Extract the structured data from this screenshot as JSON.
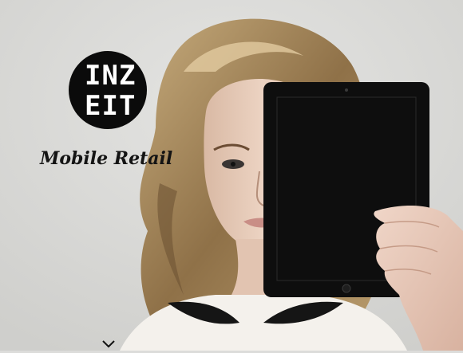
{
  "brand": {
    "logo_line1": "INZ",
    "logo_line2": "EIT"
  },
  "hero": {
    "tagline": "Mobile Retail"
  },
  "icons": {
    "scroll_indicator": "chevron-down-icon"
  },
  "colors": {
    "background": "#dcdcda",
    "logo": "#0b0b0b",
    "text": "#141414"
  }
}
